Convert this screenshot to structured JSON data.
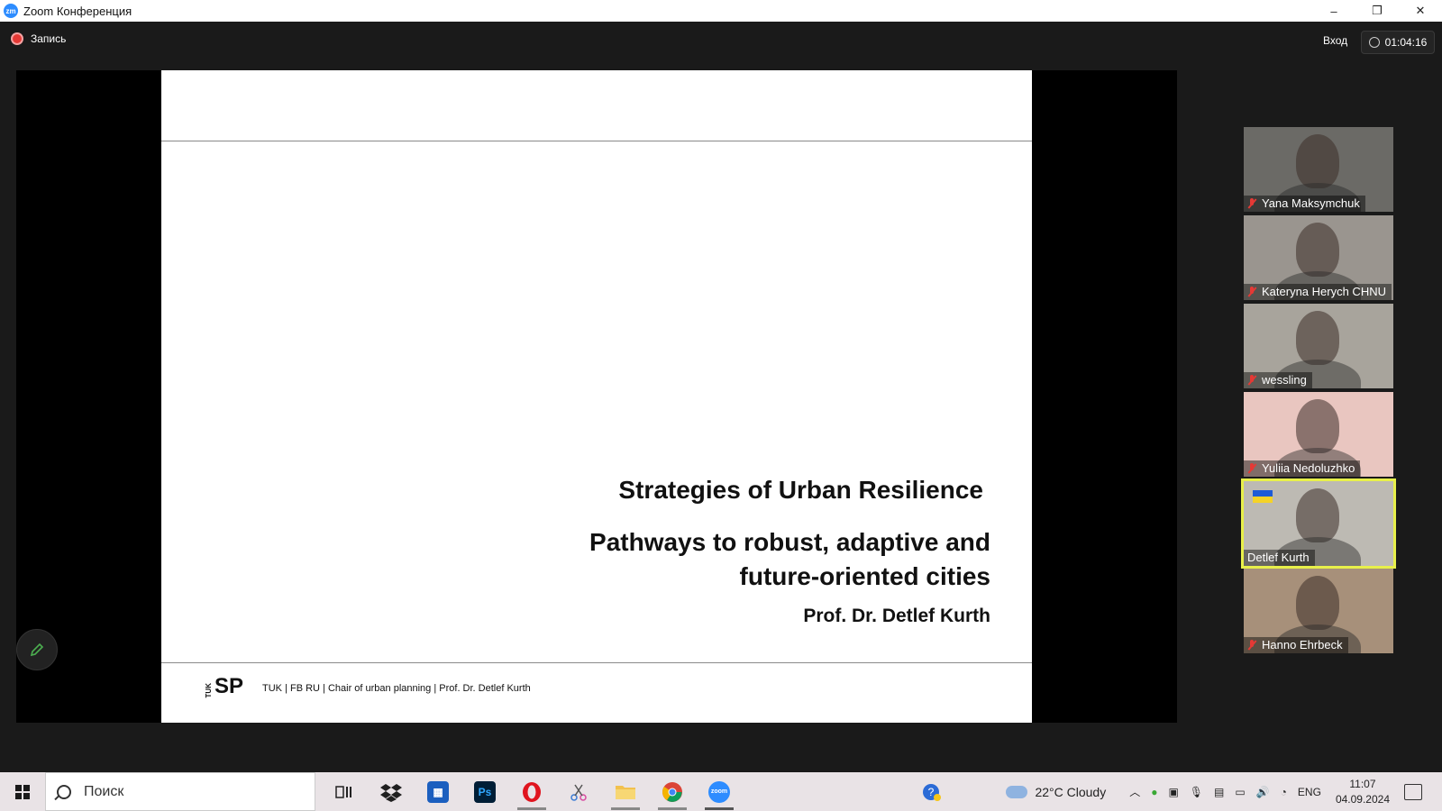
{
  "window": {
    "app_icon_text": "zm",
    "title": "Zoom Конференция",
    "controls": [
      "–",
      "❐",
      "✕"
    ]
  },
  "meeting": {
    "recording_label": "Запись",
    "enter_label": "Вход",
    "elapsed_time": "01:04:16"
  },
  "slide": {
    "title": "Strategies of Urban Resilience",
    "subtitle_line1": "Pathways to robust, adaptive and",
    "subtitle_line2": "future-oriented cities",
    "author": "Prof. Dr. Detlef Kurth",
    "logo_tuk": "TUK",
    "logo_sp": "SP",
    "footer": "TUK | FB RU | Chair of urban planning |  Prof. Dr. Detlef Kurth"
  },
  "participants": [
    {
      "name": "Yana Maksymchuk",
      "muted": true,
      "active": false,
      "bg": "#6b6a66"
    },
    {
      "name": "Kateryna Herych CHNU",
      "muted": true,
      "active": false,
      "bg": "#9a958f"
    },
    {
      "name": "wessling",
      "muted": true,
      "active": false,
      "bg": "#a8a49c"
    },
    {
      "name": "Yuliia Nedoluzhko",
      "muted": true,
      "active": false,
      "bg": "#e9c6c0"
    },
    {
      "name": "Detlef Kurth",
      "muted": false,
      "active": true,
      "bg": "#bdbab3"
    },
    {
      "name": "Hanno Ehrbeck",
      "muted": true,
      "active": false,
      "bg": "#a7907a"
    }
  ],
  "taskbar": {
    "search_placeholder": "Поиск",
    "weather": "22°C  Cloudy",
    "lang": "ENG",
    "time": "11:07",
    "date": "04.09.2024"
  }
}
